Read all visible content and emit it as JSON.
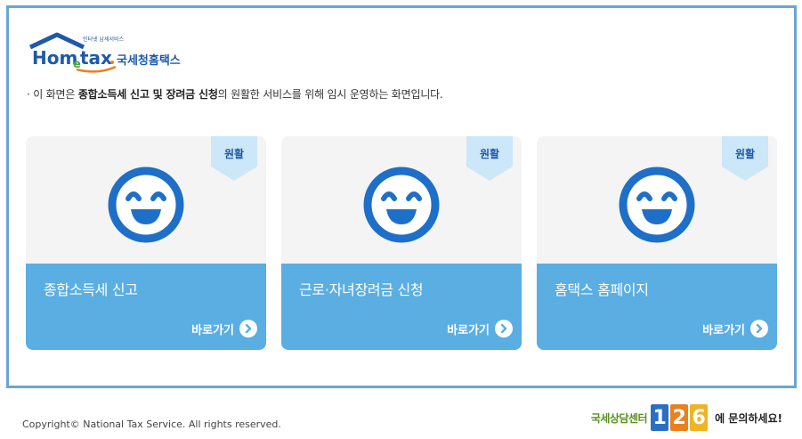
{
  "logo": {
    "brand": "Hometax",
    "org": "국세청홈택스",
    "tagline": "인터넷 납세서비스"
  },
  "notice": {
    "prefix": "· 이 화면은 ",
    "highlight": "종합소득세 신고 및 장려금 신청",
    "suffix": "의 원활한 서비스를 위해 임시 운영하는 화면입니다."
  },
  "cards": [
    {
      "badge": "원활",
      "title": "종합소득세 신고",
      "link": "바로가기",
      "icon": "smile-icon"
    },
    {
      "badge": "원활",
      "title": "근로·자녀장려금 신청",
      "link": "바로가기",
      "icon": "smile-icon"
    },
    {
      "badge": "원활",
      "title": "홈택스 홈페이지",
      "link": "바로가기",
      "icon": "smile-icon"
    }
  ],
  "footer": {
    "copyright": "Copyright© National Tax Service. All rights reserved.",
    "call_label": "국세상담센터",
    "call_number": [
      "1",
      "2",
      "6"
    ],
    "call_suffix": "에 문의하세요!"
  },
  "colors": {
    "frame": "#6aa6d3",
    "card_bottom": "#5aaee2",
    "badge_bg": "#cbe7f8",
    "badge_text": "#1e5aa8",
    "smile": "#1e6fc8"
  }
}
